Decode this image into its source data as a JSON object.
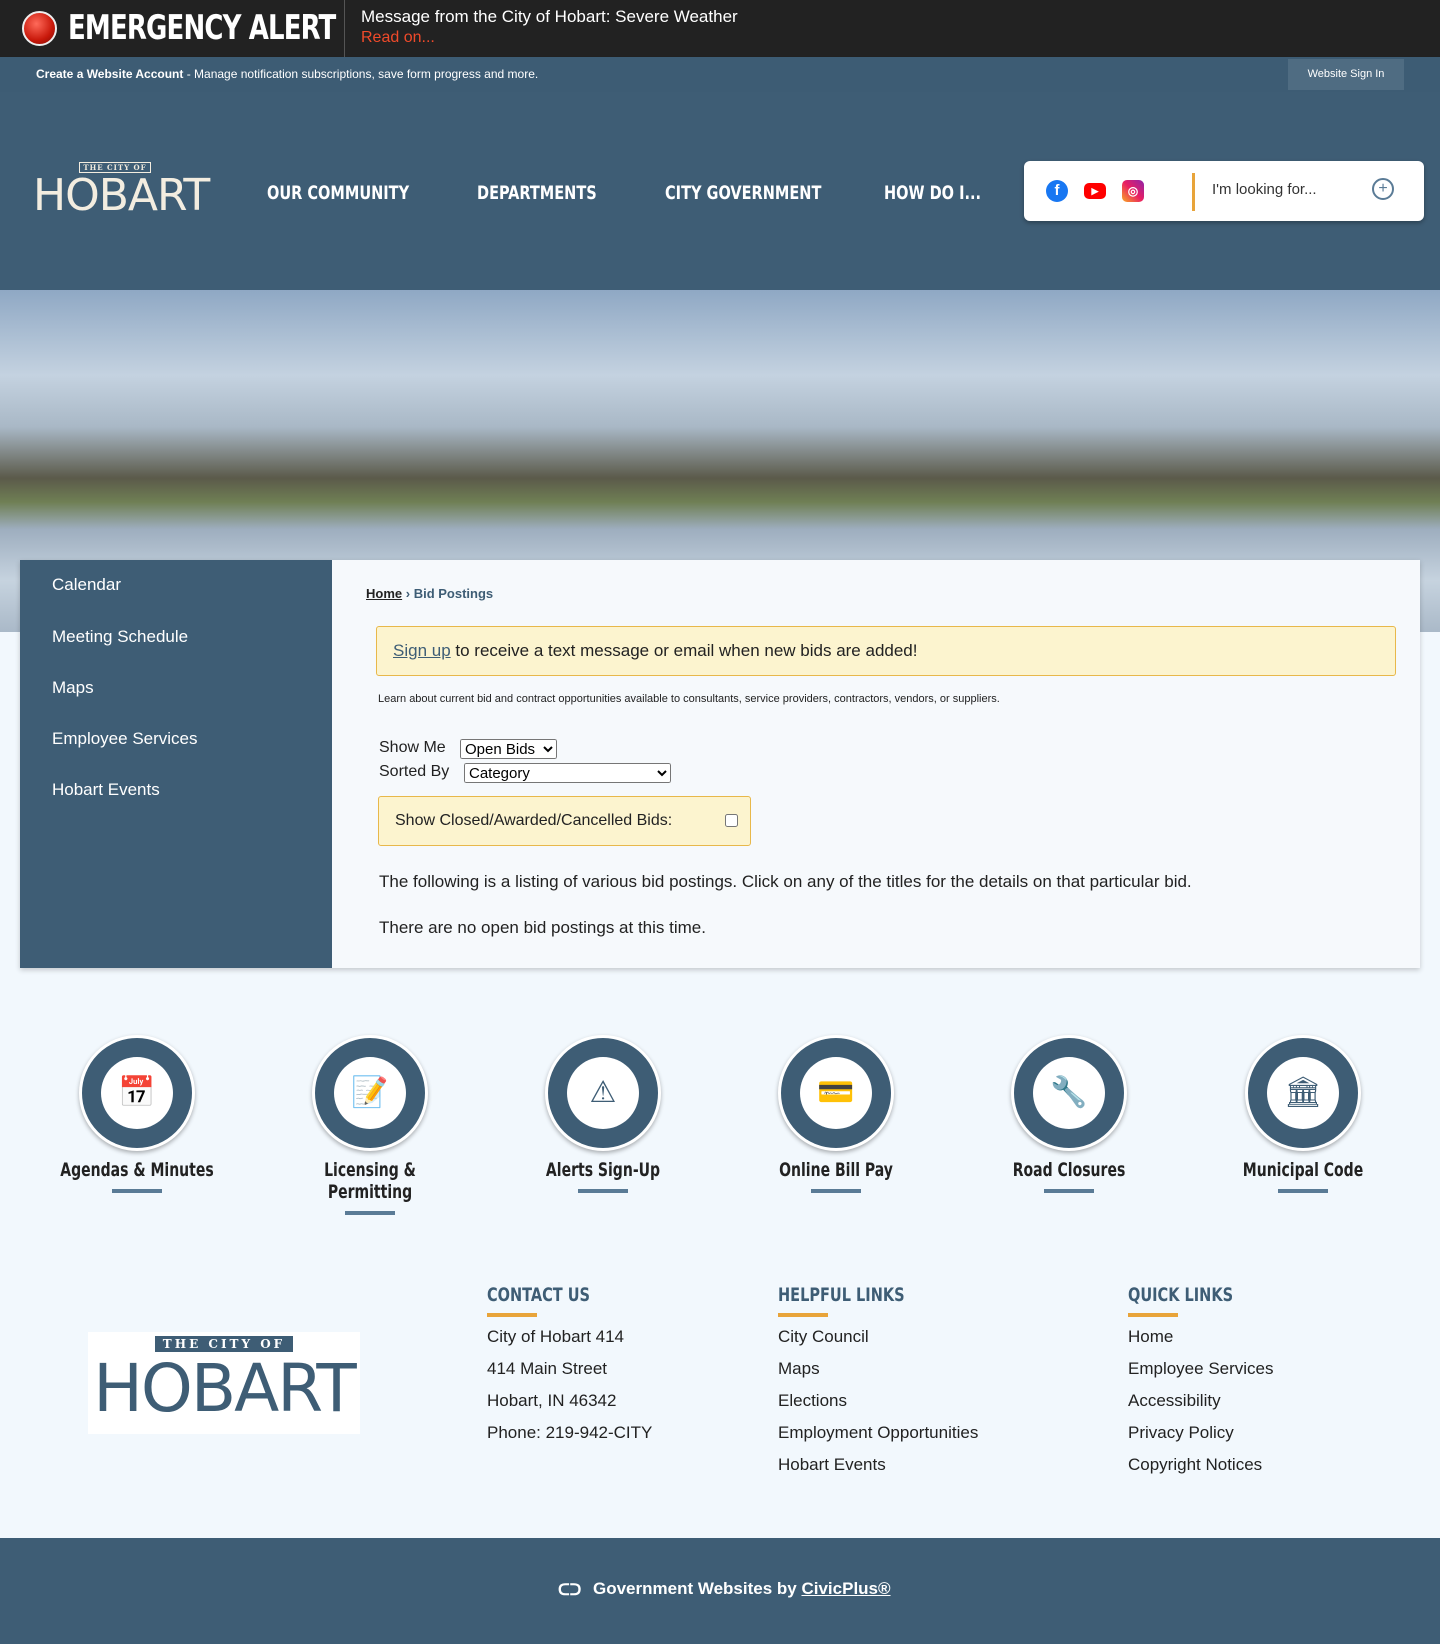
{
  "alert": {
    "title": "EMERGENCY ALERT",
    "message": "Message from the City of Hobart: Severe Weather",
    "link": "Read on..."
  },
  "account": {
    "create": "Create a Website Account",
    "rest": " - Manage notification subscriptions, save form progress and more.",
    "signin": "Website Sign In"
  },
  "logo": {
    "small": "THE CITY OF",
    "big": "HOBART"
  },
  "nav": [
    "OUR COMMUNITY",
    "DEPARTMENTS",
    "CITY GOVERNMENT",
    "HOW DO I..."
  ],
  "search": {
    "placeholder": "I'm looking for..."
  },
  "social": [
    "facebook-icon",
    "youtube-icon",
    "instagram-icon"
  ],
  "sidebar": [
    "Calendar",
    "Meeting Schedule",
    "Maps",
    "Employee Services",
    "Hobart Events"
  ],
  "breadcrumb": {
    "home": "Home",
    "sep": " › ",
    "current": "Bid Postings"
  },
  "notice": {
    "link": "Sign up",
    "text": " to receive a text message or email when new bids are added!"
  },
  "description": "Learn about current bid and contract opportunities available to consultants, service providers, contractors, vendors, or suppliers.",
  "filters": {
    "show_me_label": "Show Me",
    "show_me_value": "Open Bids",
    "sorted_by_label": "Sorted By",
    "sorted_by_value": "Category",
    "closed_label": "Show Closed/Awarded/Cancelled Bids:",
    "closed_checked": false
  },
  "listing_text": "The following is a listing of various bid postings. Click on any of the titles for the details on that particular bid.",
  "empty_text": "There are no open bid postings at this time.",
  "tiles": [
    {
      "label": "Agendas & Minutes",
      "icon": "📅"
    },
    {
      "label": "Licensing & Permitting",
      "icon": "📝"
    },
    {
      "label": "Alerts Sign-Up",
      "icon": "⚠"
    },
    {
      "label": "Online Bill Pay",
      "icon": "💳"
    },
    {
      "label": "Road Closures",
      "icon": "🔧"
    },
    {
      "label": "Municipal Code",
      "icon": "🏛"
    }
  ],
  "footer": {
    "contact": {
      "heading": "CONTACT US",
      "lines": [
        "City of Hobart 414",
        "414 Main Street",
        "Hobart, IN 46342",
        "Phone: 219-942-CITY"
      ]
    },
    "helpful": {
      "heading": "HELPFUL LINKS",
      "links": [
        "City Council",
        "Maps",
        "Elections",
        "Employment Opportunities",
        "Hobart Events"
      ]
    },
    "quick": {
      "heading": "QUICK LINKS",
      "links": [
        "Home",
        "Employee Services",
        "Accessibility",
        "Privacy Policy",
        "Copyright Notices"
      ]
    }
  },
  "bottom": {
    "text": "Government Websites by ",
    "link": "CivicPlus®"
  }
}
